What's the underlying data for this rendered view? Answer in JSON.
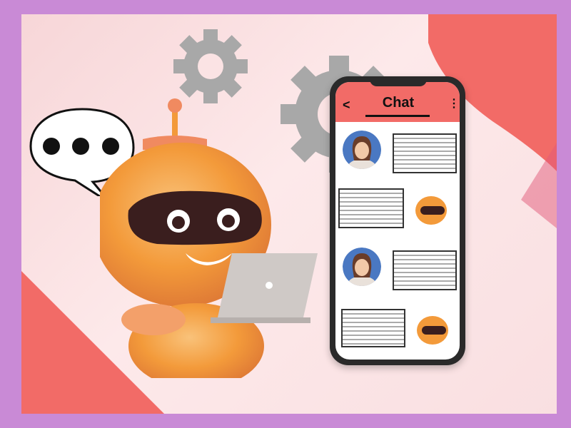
{
  "chat": {
    "back_label": "<",
    "title": "Chat",
    "menu_label": "⋮"
  },
  "colors": {
    "outer_bg": "#c98ad6",
    "accent": "#f26b67",
    "robot_orange": "#f39a3a",
    "gear": "#a8a8a8"
  },
  "icons": [
    "gear-icon",
    "speech-bubble-icon",
    "robot-icon",
    "laptop-icon",
    "person-avatar-icon",
    "robot-avatar-icon"
  ]
}
